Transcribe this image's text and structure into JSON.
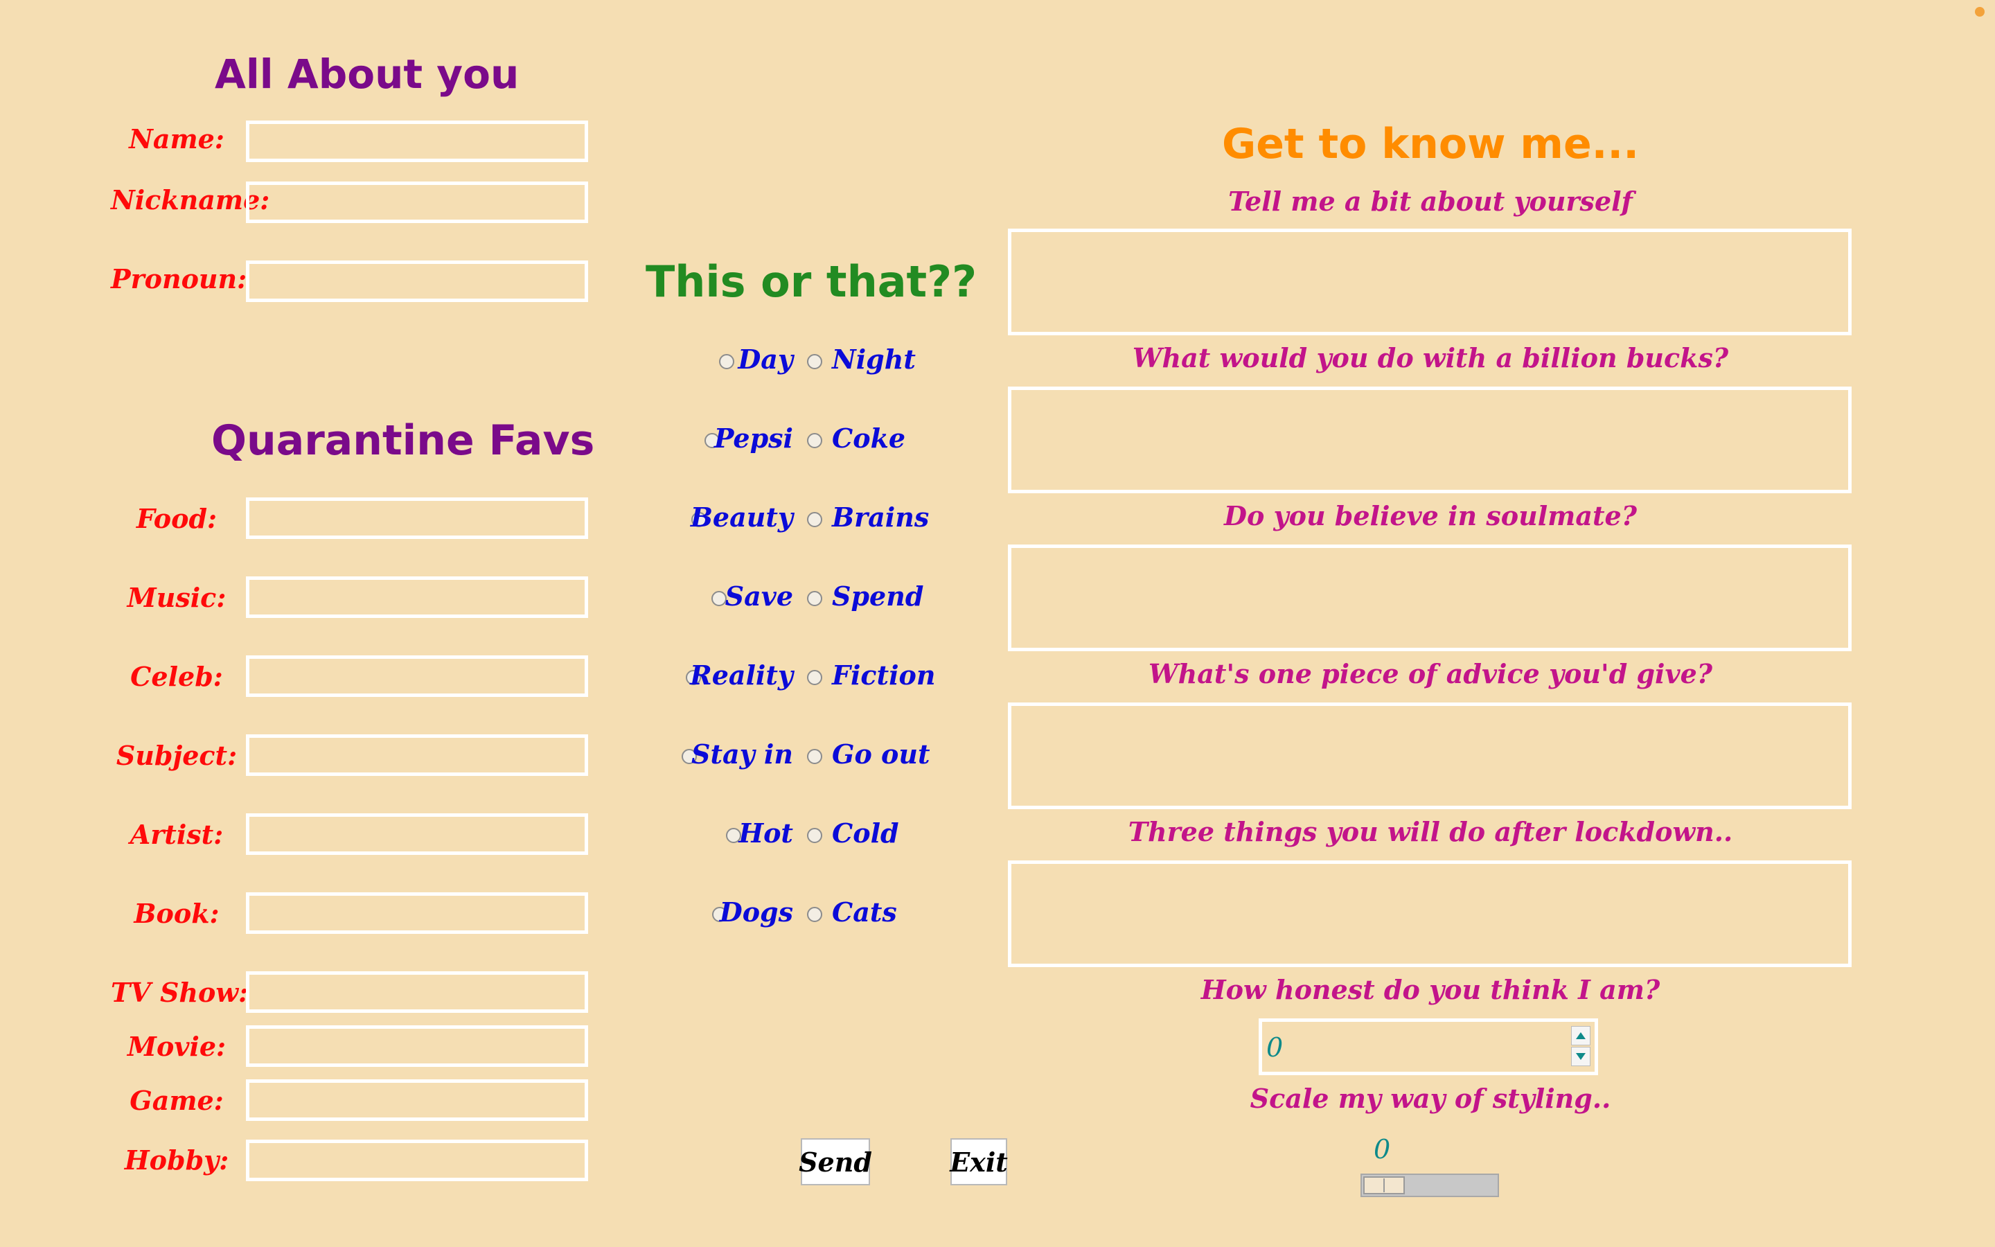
{
  "about": {
    "title": "All About you",
    "fields": [
      "Name:",
      "Nickname:",
      "Pronoun:"
    ]
  },
  "favs": {
    "title": "Quarantine Favs",
    "fields": [
      "Food:",
      "Music:",
      "Celeb:",
      "Subject:",
      "Artist:",
      "Book:",
      "TV Show:",
      "Movie:",
      "Game:",
      "Hobby:"
    ]
  },
  "this_or_that": {
    "title": "This or that??",
    "pairs": [
      [
        "Day",
        "Night"
      ],
      [
        "Pepsi",
        "Coke"
      ],
      [
        "Beauty",
        "Brains"
      ],
      [
        "Save",
        "Spend"
      ],
      [
        "Reality",
        "Fiction"
      ],
      [
        "Stay in",
        "Go out"
      ],
      [
        "Hot",
        "Cold"
      ],
      [
        "Dogs",
        "Cats"
      ]
    ]
  },
  "get_to_know": {
    "title": "Get to know me...",
    "questions": [
      "Tell me a bit about yourself",
      "What would you do with a billion bucks?",
      "Do you believe in soulmate?",
      "What's one piece of advice you'd give?",
      "Three things you will do after lockdown.."
    ],
    "honesty_question": "How honest do you think I am?",
    "honesty_value": "0",
    "style_question": "Scale my way of styling..",
    "style_value": "0"
  },
  "buttons": {
    "send": "Send",
    "exit": "Exit"
  },
  "colors": {
    "background": "#f5deb3",
    "heading_purple": "#7a0a8a",
    "heading_green": "#228b22",
    "heading_orange": "#ff8c00",
    "label_red": "#ff0a0a",
    "option_blue": "#0b0bd8",
    "question_pink": "#c2148a",
    "value_teal": "#0e8a8a"
  }
}
